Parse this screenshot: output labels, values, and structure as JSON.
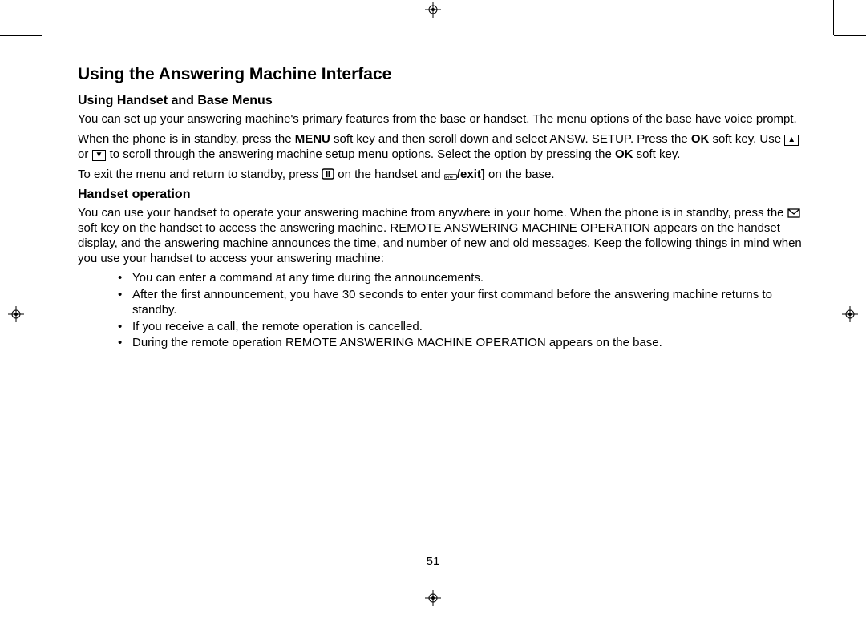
{
  "title": "Using the Answering Machine Interface",
  "section1": {
    "heading": "Using Handset and Base Menus",
    "p1": "You can set up your answering machine's primary features from the base or handset. The menu options of the base have voice prompt.",
    "p2a": "When the phone is in standby, press the ",
    "p2_menu": "MENU",
    "p2b": " soft key and then scroll down and select ANSW. SETUP. Press the ",
    "p2_ok1": "OK",
    "p2c": " soft key. Use ",
    "p2d": " or ",
    "p2e": " to scroll through the answering machine setup menu options. Select the option by pressing the ",
    "p2_ok2": "OK",
    "p2f": " soft key.",
    "p3a": "To exit the menu and return to standby, press ",
    "p3b": " on the handset and ",
    "p3_exit": "/exit",
    "p3c": " on the base."
  },
  "section2": {
    "heading": "Handset operation",
    "p1a": "You can use your handset to operate your answering machine from anywhere in your home. When the phone is in standby, press the ",
    "p1b": " soft key on the handset to access the answering machine. REMOTE ANSWERING MACHINE OPERATION appears on the handset display, and the answering machine announces the time, and number of new and old messages. Keep the following things in mind when you use your handset to access your answering machine:",
    "bullets": [
      "You can enter a command at any time during the announcements.",
      "After the first announcement, you have 30 seconds to enter your first command before the answering machine returns to standby.",
      "If you receive a call, the remote operation is cancelled.",
      "During the remote operation REMOTE ANSWERING MACHINE OPERATION appears on the base."
    ]
  },
  "page_number": "51"
}
